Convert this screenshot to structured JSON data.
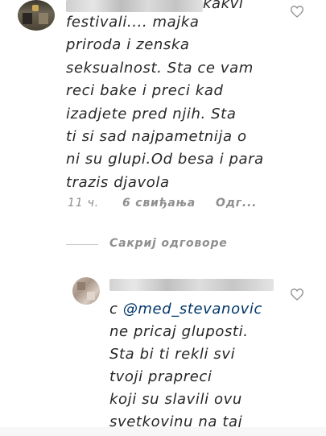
{
  "comment1": {
    "username_partial": "kakvi",
    "text": "festivali.... majka\npriroda i zenska\nseksualnost. Sta ce vam\nreci bake i preci kad\nizadjete pred njih. Sta\nti si sad najpametnija o\nni su glupi.Od besa i para\ntrazis djavola",
    "time": "11 ч.",
    "likes": "6 свиђања",
    "reply": "Одг..."
  },
  "hide_replies": "Сакриј одговоре",
  "reply1": {
    "prefix": "c",
    "mention": "@med_stevanovic",
    "text": "ne pricaj gluposti.\nSta bi ti rekli svi\ntvoji prapreci\nkoji su slavili ovu\nsvetkovinu na taj"
  },
  "colors": {
    "text": "#262626",
    "meta": "#8e8e8e",
    "mention": "#003569"
  },
  "icons": {
    "like": "heart-outline-icon"
  }
}
